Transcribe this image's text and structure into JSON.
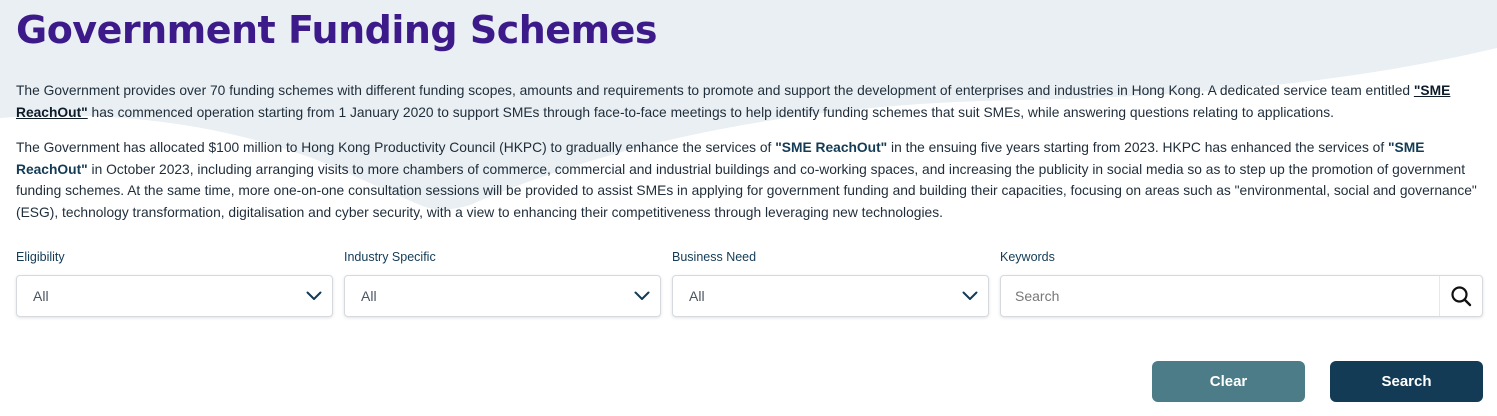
{
  "page": {
    "title": "Government Funding Schemes"
  },
  "intro": {
    "p1_part1": "The Government provides over 70 funding schemes with different funding scopes, amounts and requirements to promote and support the development of enterprises and industries in Hong Kong. A dedicated service team entitled ",
    "p1_highlight": "\"SME ReachOut\"",
    "p1_part2": " has commenced operation starting from 1 January 2020 to support SMEs through face-to-face meetings to help identify funding schemes that suit SMEs, while answering questions relating to applications.",
    "p2_part1": "The Government has allocated $100 million to Hong Kong Productivity Council (HKPC) to gradually enhance the services of ",
    "p2_highlight1": "\"SME ReachOut\"",
    "p2_part2": " in the ensuing five years starting from 2023. HKPC has enhanced the services of ",
    "p2_highlight2": "\"SME ReachOut\"",
    "p2_part3": " in October 2023, including arranging visits to more chambers of commerce, commercial and industrial buildings and co-working spaces, and increasing the publicity in social media so as to step up the promotion of government funding schemes. At the same time, more one-on-one consultation sessions will be provided to assist SMEs in applying for government funding and building their capacities, focusing on areas such as \"environmental, social and governance\" (ESG), technology transformation, digitalisation and cyber security, with a view to enhancing their competitiveness through leveraging new technologies."
  },
  "filters": {
    "eligibility": {
      "label": "Eligibility",
      "value": "All"
    },
    "industry": {
      "label": "Industry Specific",
      "value": "All"
    },
    "business_need": {
      "label": "Business Need",
      "value": "All"
    },
    "keywords": {
      "label": "Keywords",
      "placeholder": "Search"
    }
  },
  "actions": {
    "clear_label": "Clear",
    "search_label": "Search"
  },
  "colors": {
    "title": "#3d1a8a",
    "highlight": "#133b55",
    "clear_button": "#4b7c87",
    "search_button": "#133b55",
    "background_shape": "#e9eff2"
  },
  "icons": {
    "dropdown": "chevron-down-icon",
    "search": "magnifier-icon"
  }
}
